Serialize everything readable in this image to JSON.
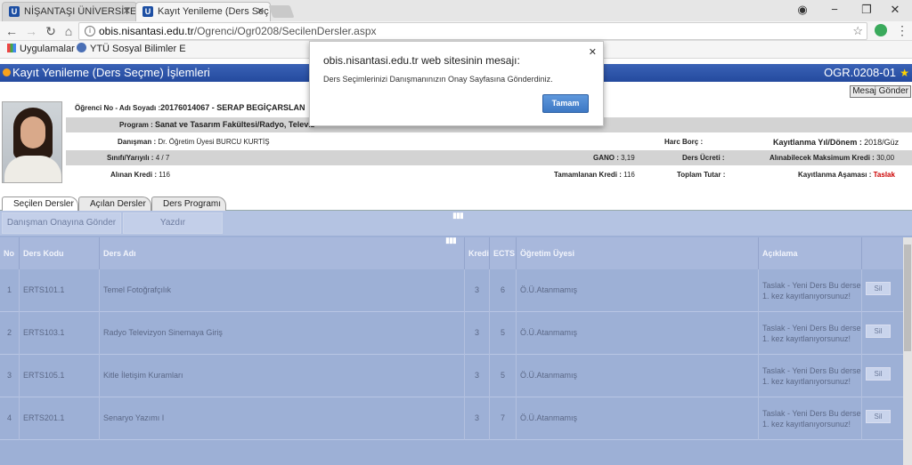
{
  "browser": {
    "tabs": [
      {
        "title": "NİŞANTAŞI ÜNİVERSİTES",
        "favicon": "U",
        "active": false
      },
      {
        "title": "Kayıt Yenileme (Ders Seç",
        "favicon": "U",
        "active": true
      }
    ],
    "url_host": "obis.nisantasi.edu.tr",
    "url_path": "/Ogrenci/Ogr0208/SecilenDersler.aspx",
    "bookmarks": [
      {
        "label": "Uygulamalar",
        "icon": "apps-grid-icon"
      },
      {
        "label": "YTÜ Sosyal Bilimler E",
        "icon": "globe-icon"
      }
    ]
  },
  "page": {
    "title": "Kayıt Yenileme (Ders Seçme) İşlemleri",
    "code": "OGR.0208-01",
    "message_button": "Mesaj Gönder"
  },
  "student": {
    "id_label": "Öğrenci No - Adı Soyadı :",
    "id_value": "20176014067 - SERAP BEGİÇARSLAN",
    "program_label": "Program :",
    "program_value": "Sanat ve Tasarım Fakültesi/Radyo, Televiz",
    "advisor_label": "Danışman :",
    "advisor_value": "Dr. Öğretim Üyesi BURCU KURTİŞ",
    "fee_label": "Harc Borç :",
    "term_label": "Kayıtlanma Yıl/Dönem :",
    "term_value": "2018/Güz",
    "class_label": "Sınıfı/Yarıyılı :",
    "class_value": "4 / 7",
    "gano_label": "GANO :",
    "gano_value": "3,19",
    "course_fee_label": "Ders Ücreti :",
    "max_credit_label": "Alınabilecek Maksimum Kredi :",
    "max_credit_value": "30,00",
    "taken_credit_label": "Alınan Kredi :",
    "taken_credit_value": "116",
    "completed_credit_label": "Tamamlanan Kredi :",
    "completed_credit_value": "116",
    "total_label": "Toplam Tutar :",
    "stage_label": "Kayıtlanma Aşaması :",
    "stage_value": "Taslak"
  },
  "page_tabs": [
    "Seçilen Dersler",
    "Açılan Dersler",
    "Ders Programı"
  ],
  "toolbar": {
    "send_button": "Danışman Onayına Gönder",
    "print_button": "Yazdır"
  },
  "table": {
    "headers": [
      "No",
      "Ders Kodu",
      "Ders Adı",
      "Kredi",
      "ECTS",
      "Öğretim Üyesi",
      "Açıklama"
    ],
    "rows": [
      {
        "no": "1",
        "code": "ERTS101.1",
        "name": "Temel Fotoğrafçılık",
        "credit": "3",
        "ects": "6",
        "instructor": "Ö.Ü.Atanmamış",
        "desc": "Taslak - Yeni Ders Bu derse 1. kez kayıtlanıyorsunuz!",
        "action": "Sil"
      },
      {
        "no": "2",
        "code": "ERTS103.1",
        "name": "Radyo Televizyon Sinemaya Giriş",
        "credit": "3",
        "ects": "5",
        "instructor": "Ö.Ü.Atanmamış",
        "desc": "Taslak - Yeni Ders Bu derse 1. kez kayıtlanıyorsunuz!",
        "action": "Sil"
      },
      {
        "no": "3",
        "code": "ERTS105.1",
        "name": "Kitle İletişim Kuramları",
        "credit": "3",
        "ects": "5",
        "instructor": "Ö.Ü.Atanmamış",
        "desc": "Taslak - Yeni Ders Bu derse 1. kez kayıtlanıyorsunuz!",
        "action": "Sil"
      },
      {
        "no": "4",
        "code": "ERTS201.1",
        "name": "Senaryo Yazımı I",
        "credit": "3",
        "ects": "7",
        "instructor": "Ö.Ü.Atanmamış",
        "desc": "Taslak - Yeni Ders Bu derse 1. kez kayıtlanıyorsunuz!",
        "action": "Sil"
      }
    ]
  },
  "dialog": {
    "title": "obis.nisantasi.edu.tr web sitesinin mesajı:",
    "message": "Ders Seçimlerinizi Danışmanınızın Onay Sayfasına Gönderdiniz.",
    "ok_button": "Tamam"
  },
  "colors": {
    "header_blue": "#2f57aa",
    "stage_red": "#cc0000",
    "dialog_button": "#4a84cf"
  }
}
